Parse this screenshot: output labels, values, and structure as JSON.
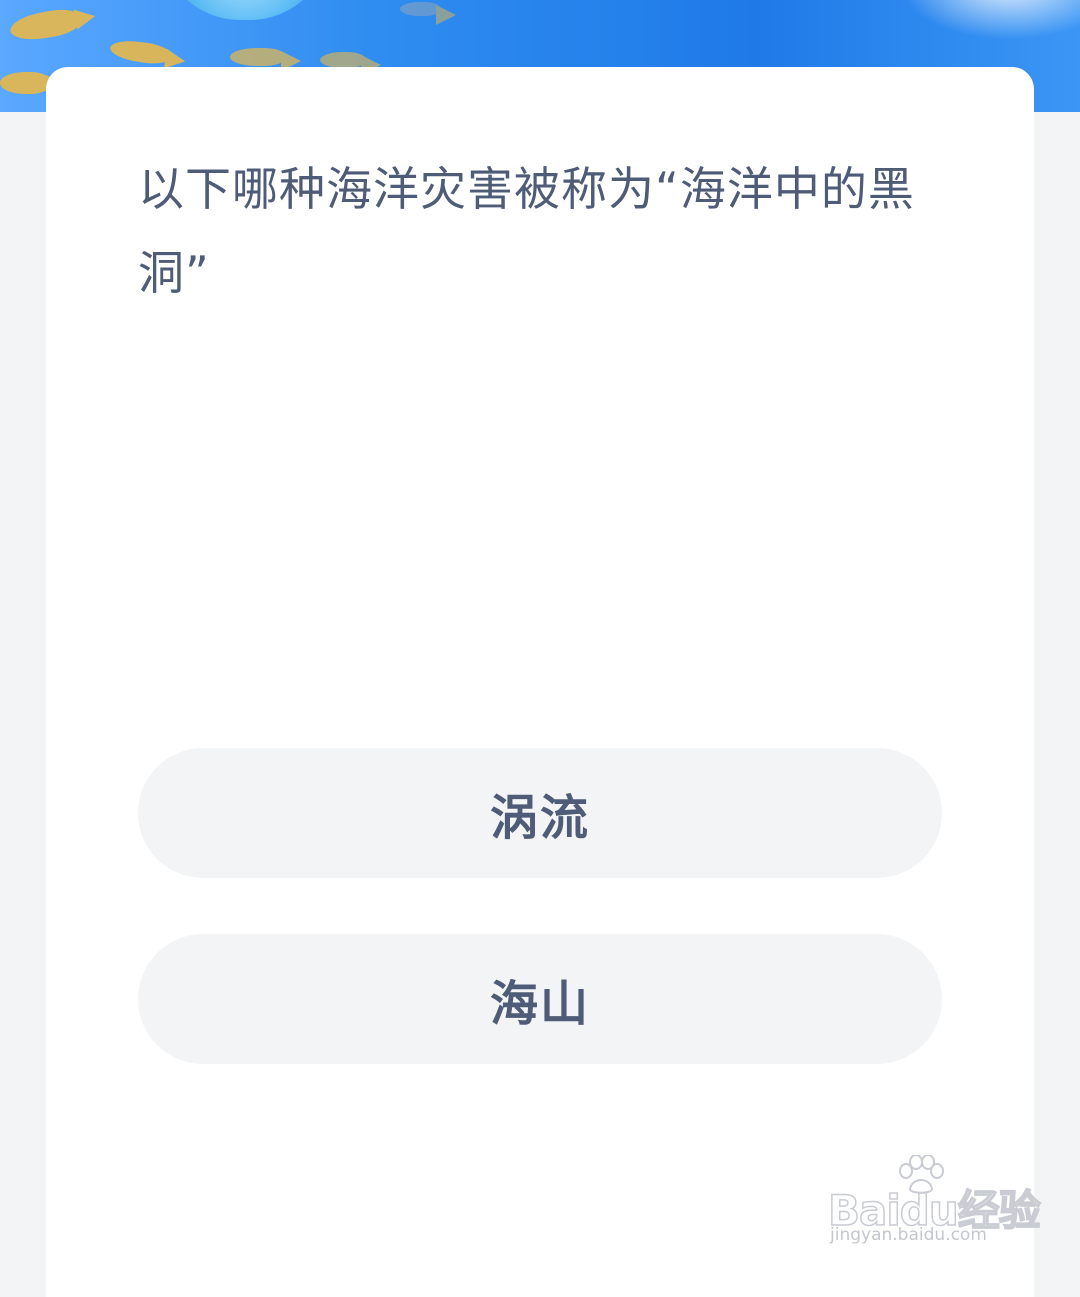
{
  "question": {
    "text": "以下哪种海洋灾害被称为“海洋中的黑洞”"
  },
  "options": [
    {
      "label": "涡流"
    },
    {
      "label": "海山"
    }
  ],
  "watermark": {
    "brand": "Baidu经验",
    "url": "jingyan.baidu.com"
  },
  "colors": {
    "text": "#4f5c78",
    "option_bg": "#f3f4f6",
    "hero_blue": "#2f8cf0",
    "card_bg": "#ffffff"
  }
}
